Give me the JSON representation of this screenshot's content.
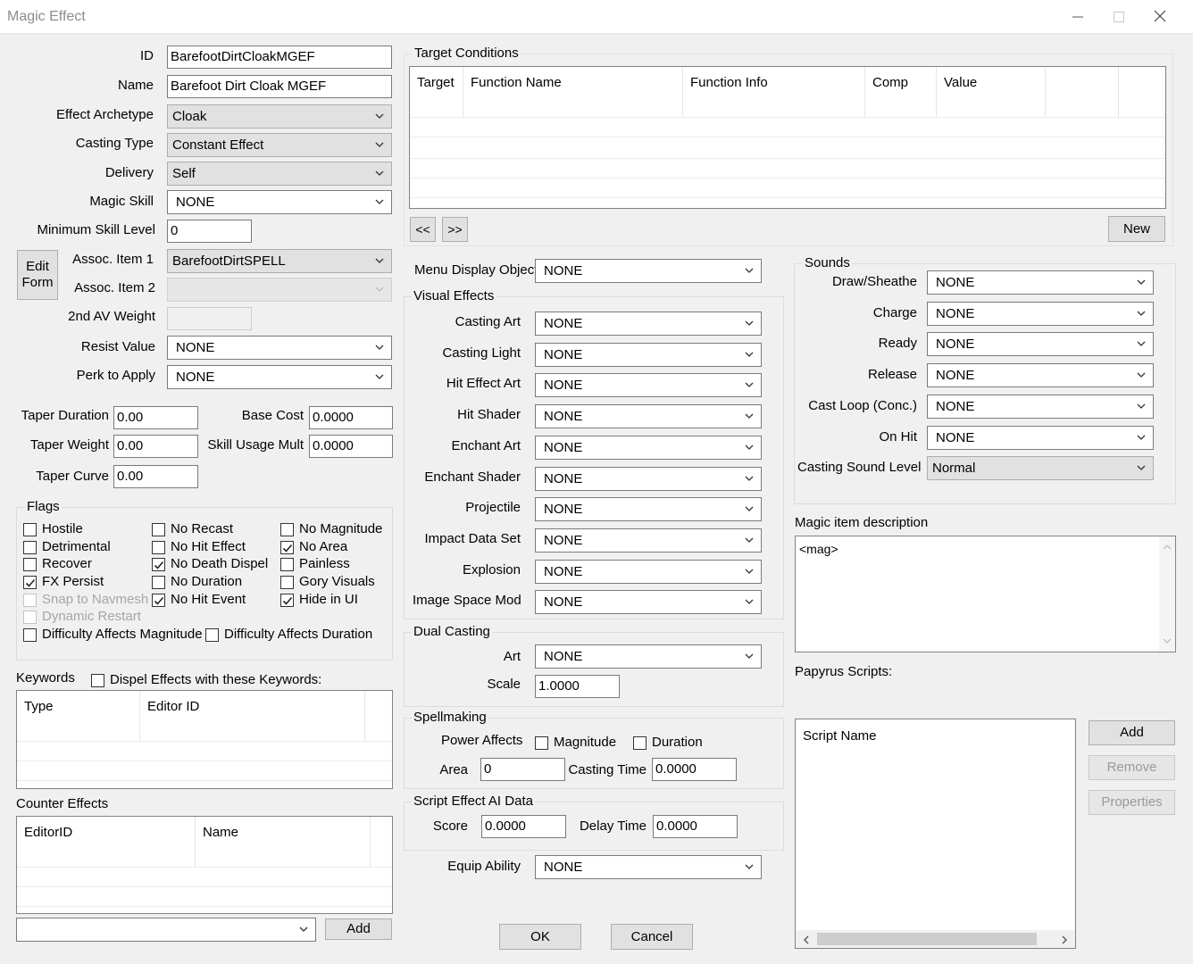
{
  "window": {
    "title": "Magic Effect"
  },
  "left": {
    "id_label": "ID",
    "id_value": "BarefootDirtCloakMGEF",
    "name_label": "Name",
    "name_value": "Barefoot Dirt Cloak MGEF",
    "archetype_label": "Effect Archetype",
    "archetype_value": "Cloak",
    "casting_type_label": "Casting Type",
    "casting_type_value": "Constant Effect",
    "delivery_label": "Delivery",
    "delivery_value": "Self",
    "magic_skill_label": "Magic Skill",
    "magic_skill_value": "NONE",
    "min_skill_label": "Minimum Skill Level",
    "min_skill_value": "0",
    "edit_form_line1": "Edit",
    "edit_form_line2": "Form",
    "assoc1_label": "Assoc. Item 1",
    "assoc1_value": "BarefootDirtSPELL",
    "assoc2_label": "Assoc. Item 2",
    "av_weight_label": "2nd AV Weight",
    "resist_label": "Resist Value",
    "resist_value": "NONE",
    "perk_label": "Perk to Apply",
    "perk_value": "NONE",
    "taper_duration_label": "Taper Duration",
    "taper_duration_value": "0.00",
    "taper_weight_label": "Taper Weight",
    "taper_weight_value": "0.00",
    "taper_curve_label": "Taper Curve",
    "taper_curve_value": "0.00",
    "base_cost_label": "Base Cost",
    "base_cost_value": "0.0000",
    "skill_mult_label": "Skill Usage Mult",
    "skill_mult_value": "0.0000"
  },
  "flags": {
    "title": "Flags",
    "items": [
      {
        "label": "Hostile",
        "checked": false,
        "enabled": true
      },
      {
        "label": "Detrimental",
        "checked": false,
        "enabled": true
      },
      {
        "label": "Recover",
        "checked": false,
        "enabled": true
      },
      {
        "label": "FX Persist",
        "checked": true,
        "enabled": true
      },
      {
        "label": "Snap to Navmesh",
        "checked": false,
        "enabled": false
      },
      {
        "label": "Dynamic Restart",
        "checked": false,
        "enabled": false
      },
      {
        "label": "No Recast",
        "checked": false,
        "enabled": true
      },
      {
        "label": "No Hit Effect",
        "checked": false,
        "enabled": true
      },
      {
        "label": "No Death Dispel",
        "checked": true,
        "enabled": true
      },
      {
        "label": "No Duration",
        "checked": false,
        "enabled": true
      },
      {
        "label": "No Hit Event",
        "checked": true,
        "enabled": true
      },
      {
        "label": "No Magnitude",
        "checked": false,
        "enabled": true
      },
      {
        "label": "No Area",
        "checked": true,
        "enabled": true
      },
      {
        "label": "Painless",
        "checked": false,
        "enabled": true
      },
      {
        "label": "Gory Visuals",
        "checked": false,
        "enabled": true
      },
      {
        "label": "Hide in UI",
        "checked": true,
        "enabled": true
      },
      {
        "label": "Difficulty Affects Magnitude",
        "checked": false,
        "enabled": true
      },
      {
        "label": "Difficulty Affects Duration",
        "checked": false,
        "enabled": true
      }
    ]
  },
  "keywords": {
    "title": "Keywords",
    "dispel_label": "Dispel Effects with these Keywords:",
    "columns": [
      "Type",
      "Editor ID"
    ]
  },
  "counter_effects": {
    "title": "Counter Effects",
    "columns": [
      "EditorID",
      "Name"
    ],
    "add_label": "Add"
  },
  "target_conditions": {
    "title": "Target Conditions",
    "columns": [
      "Target",
      "Function Name",
      "Function Info",
      "Comp",
      "Value"
    ],
    "prev_label": "<<",
    "next_label": ">>",
    "new_label": "New"
  },
  "menu_display": {
    "label": "Menu Display Object",
    "value": "NONE"
  },
  "visual_effects": {
    "title": "Visual Effects",
    "rows": [
      {
        "label": "Casting Art",
        "value": "NONE"
      },
      {
        "label": "Casting Light",
        "value": "NONE"
      },
      {
        "label": "Hit Effect Art",
        "value": "NONE"
      },
      {
        "label": "Hit Shader",
        "value": "NONE"
      },
      {
        "label": "Enchant Art",
        "value": "NONE"
      },
      {
        "label": "Enchant Shader",
        "value": "NONE"
      },
      {
        "label": "Projectile",
        "value": "NONE"
      },
      {
        "label": "Impact Data Set",
        "value": "NONE"
      },
      {
        "label": "Explosion",
        "value": "NONE"
      },
      {
        "label": "Image Space Mod",
        "value": "NONE"
      }
    ]
  },
  "dual_casting": {
    "title": "Dual Casting",
    "art_label": "Art",
    "art_value": "NONE",
    "scale_label": "Scale",
    "scale_value": "1.0000"
  },
  "spellmaking": {
    "title": "Spellmaking",
    "power_label": "Power Affects",
    "magnitude_label": "Magnitude",
    "duration_label": "Duration",
    "area_label": "Area",
    "area_value": "0",
    "casting_time_label": "Casting Time",
    "casting_time_value": "0.0000"
  },
  "script_ai": {
    "title": "Script Effect AI Data",
    "score_label": "Score",
    "score_value": "0.0000",
    "delay_label": "Delay Time",
    "delay_value": "0.0000"
  },
  "equip": {
    "label": "Equip Ability",
    "value": "NONE"
  },
  "buttons": {
    "ok": "OK",
    "cancel": "Cancel"
  },
  "sounds": {
    "title": "Sounds",
    "rows": [
      {
        "label": "Draw/Sheathe",
        "value": "NONE"
      },
      {
        "label": "Charge",
        "value": "NONE"
      },
      {
        "label": "Ready",
        "value": "NONE"
      },
      {
        "label": "Release",
        "value": "NONE"
      },
      {
        "label": "Cast Loop (Conc.)",
        "value": "NONE"
      },
      {
        "label": "On Hit",
        "value": "NONE"
      },
      {
        "label": "Casting Sound Level",
        "value": "Normal"
      }
    ]
  },
  "description": {
    "label": "Magic item description",
    "text": "<mag>"
  },
  "scripts": {
    "label": "Papyrus Scripts:",
    "column": "Script Name",
    "add_label": "Add",
    "remove_label": "Remove",
    "properties_label": "Properties"
  }
}
